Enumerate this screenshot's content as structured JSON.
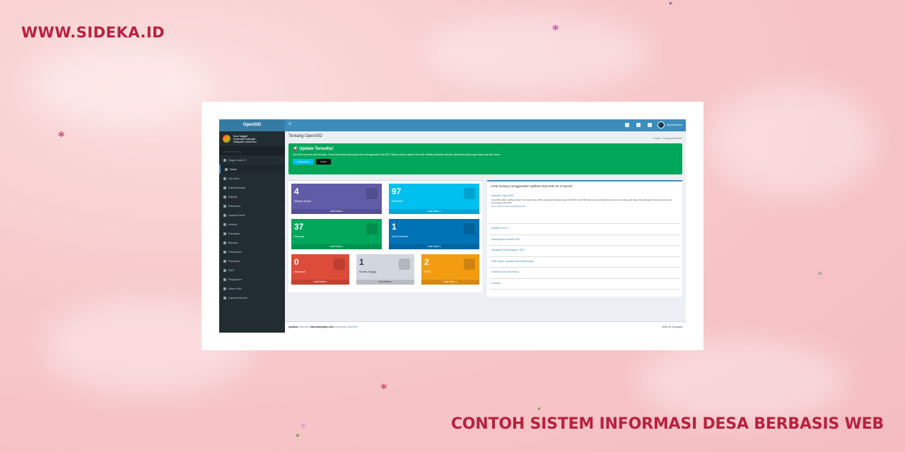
{
  "brand": "WWW.SIDEKA.ID",
  "caption": "CONTOH SISTEM INFORMASI DESA BERBASIS WEB",
  "colors": {
    "brand_red": "#b8213f",
    "header_blue": "#3c8dbc",
    "sidebar_dark": "#222d32",
    "alert_green": "#00a65a"
  },
  "app": {
    "logo": "OpenSID",
    "village": {
      "line1": "Desa Tanggkil",
      "line2": "Kecamatan Sukmajati",
      "line3": "Kabupaten Contoh Asri"
    },
    "nav_header": "NAVIGASI UTAMA",
    "nav": [
      {
        "label": "Siaga Covid-19",
        "icon": "virus-icon",
        "chevron": true,
        "active": false
      },
      {
        "label": "Home",
        "icon": "home-icon",
        "chevron": false,
        "active": true
      },
      {
        "label": "Info Desa",
        "icon": "info-icon",
        "chevron": true,
        "active": false
      },
      {
        "label": "Kependudukan",
        "icon": "users-icon",
        "chevron": true,
        "active": false
      },
      {
        "label": "Statistik",
        "icon": "chart-icon",
        "chevron": true,
        "active": false
      },
      {
        "label": "Sekretariat",
        "icon": "folder-icon",
        "chevron": true,
        "active": false
      },
      {
        "label": "Layanan Surat",
        "icon": "mail-icon",
        "chevron": true,
        "active": false
      },
      {
        "label": "Analisis",
        "icon": "analysis-icon",
        "chevron": false,
        "active": false
      },
      {
        "label": "Keuangan",
        "icon": "money-icon",
        "chevron": true,
        "active": false
      },
      {
        "label": "Bantuan",
        "icon": "heart-icon",
        "chevron": false,
        "active": false
      },
      {
        "label": "Pertanahan",
        "icon": "map-icon",
        "chevron": false,
        "active": false
      },
      {
        "label": "Pemetaan",
        "icon": "globe-icon",
        "chevron": true,
        "active": false
      },
      {
        "label": "SMS",
        "icon": "sms-icon",
        "chevron": true,
        "active": false
      },
      {
        "label": "Pengaturan",
        "icon": "gear-icon",
        "chevron": true,
        "active": false
      },
      {
        "label": "Admin Web",
        "icon": "desktop-icon",
        "chevron": true,
        "active": false
      },
      {
        "label": "Layanan Mandiri",
        "icon": "user-icon",
        "chevron": false,
        "active": false
      }
    ],
    "topbar": {
      "user_name": "Administrator"
    },
    "page_title": "Tentang OpenSID",
    "breadcrumb": {
      "home": "Home",
      "current": "Tentang OpenSID"
    },
    "alert": {
      "title": "Update Tersedia!",
      "text": "OpenSID versi baru telah tersedia. Terima kasih atas kepercayaan Anda menggunakan OpenSID. Silakan periksa catatan rilis untuk melihat perubahan sebelum melakukan update agar tetap aman dan lancar.",
      "btn_release": "Catatan Rilis",
      "btn_download": "Unduh"
    },
    "stats": [
      {
        "num": "4",
        "label": "Wilayah Dusun",
        "more": "Lihat Detail",
        "color": "#605ca8"
      },
      {
        "num": "97",
        "label": "Penduduk",
        "more": "Lihat Detail",
        "color": "#00c0ef"
      },
      {
        "num": "37",
        "label": "Keluarga",
        "more": "Lihat Detail",
        "color": "#00a65a"
      },
      {
        "num": "1",
        "label": "Surat Tercetak",
        "more": "Lihat Detail",
        "color": "#0073b7"
      },
      {
        "num": "0",
        "label": "Kelompok",
        "more": "Lihat Detail",
        "color": "#dd4b39"
      },
      {
        "num": "1",
        "label": "Rumah Tangga",
        "more": "Lihat Detail",
        "color": "#d2d6de"
      },
      {
        "num": "2",
        "label": "BPNT",
        "more": "Lihat Detail",
        "color": "#f39c12"
      }
    ],
    "about": {
      "title": "Anda sedang menggunakan aplikasi OpenSID 20.12-pasca",
      "items": [
        "Aplikasi OpenSID",
        "Apakah SID ?",
        "Manajemen Akses SID",
        "Tahapan Membangun SID",
        "Hak Cipta, Syarat Dan Ketentuan",
        "Kontak Dan Informasi",
        "Donasi"
      ],
      "desc": "OpenSID adalah aplikasi Sistem Informasi Desa (SID) yang dikembangkan sejak Mei 2016. OpenSID dirancang dan dikelola bersama komunitas agar dapat dikembangkan bersama-sama oleh komunitas peduli SID.",
      "link": "https://github.com/OpenSID/opensid"
    },
    "footer": {
      "prefix": "Aplikasi",
      "app": "OpenSID",
      "mid": "dikembangkan oleh",
      "community": "Komunitas OpenSID",
      "version": "Versi 20.12-pasca"
    }
  }
}
